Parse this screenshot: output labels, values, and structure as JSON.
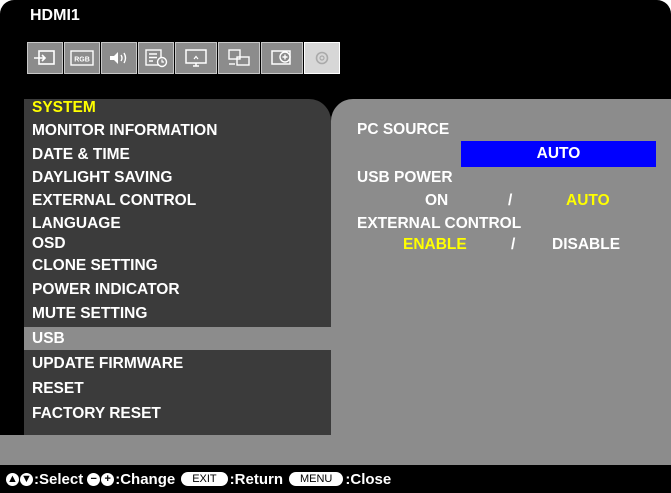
{
  "input_name": "HDMI1",
  "toolbar_icons": [
    {
      "name": "input-icon"
    },
    {
      "name": "rgb-picture-icon",
      "text": "RGB"
    },
    {
      "name": "audio-icon"
    },
    {
      "name": "schedule-icon"
    },
    {
      "name": "monitor-icon"
    },
    {
      "name": "multi-display-icon"
    },
    {
      "name": "protect-icon"
    },
    {
      "name": "system-icon"
    }
  ],
  "menu": {
    "header": "SYSTEM",
    "items": [
      "MONITOR INFORMATION",
      "DATE & TIME",
      "DAYLIGHT SAVING",
      "EXTERNAL CONTROL",
      "LANGUAGE",
      "OSD",
      "CLONE SETTING",
      "POWER INDICATOR",
      "MUTE SETTING",
      "USB",
      "UPDATE FIRMWARE",
      "RESET",
      "FACTORY RESET"
    ],
    "selected": "USB"
  },
  "settings": {
    "pc_source": {
      "label": "PC SOURCE",
      "value": "AUTO"
    },
    "usb_power": {
      "label": "USB POWER",
      "option_a": "ON",
      "separator": "/",
      "option_b": "AUTO"
    },
    "external_control": {
      "label": "EXTERNAL CONTROL",
      "option_a": "ENABLE",
      "separator": "/",
      "option_b": "DISABLE"
    }
  },
  "footer": {
    "select": ":Select",
    "change": ":Change",
    "exit_key": "EXIT",
    "return": ":Return",
    "menu_key": "MENU",
    "close": ":Close"
  },
  "colors": {
    "highlight_text": "#ffff00",
    "selection_box": "#0000ff",
    "panel_gray": "#8c8c8c",
    "panel_dark": "#3b3b3b"
  }
}
